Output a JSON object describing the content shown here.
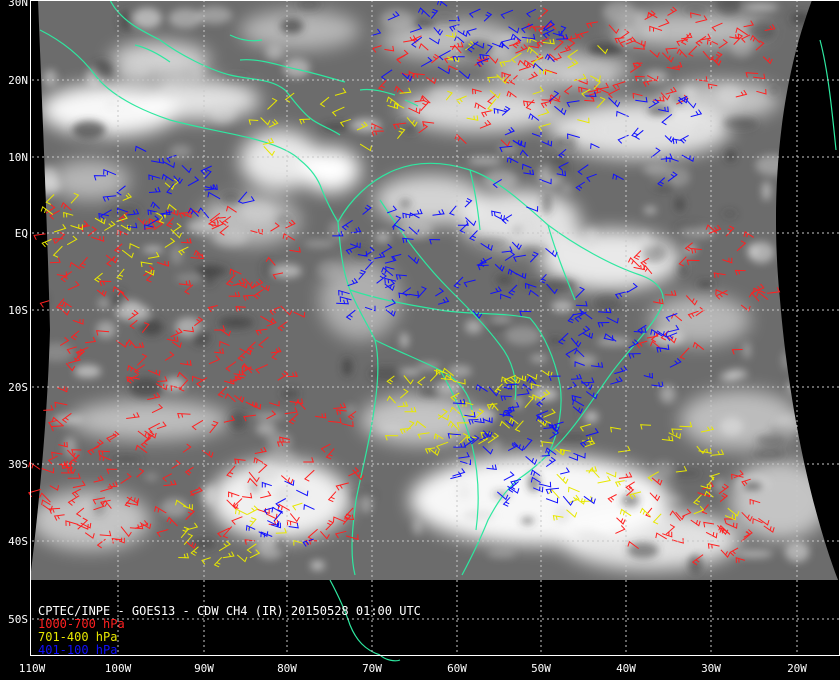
{
  "map": {
    "title": "CPTEC/INPE - GOES13 - CDW CH4 (IR) 20150528 01:00 UTC",
    "lat_labels": [
      "30N",
      "20N",
      "10N",
      "EQ",
      "10S",
      "20S",
      "30S",
      "40S",
      "50S"
    ],
    "lon_labels": [
      "110W",
      "100W",
      "90W",
      "80W",
      "70W",
      "60W",
      "50W",
      "40W",
      "30W",
      "20W"
    ],
    "legend": [
      {
        "label": "1000-700 hPa",
        "color": "#ff2020"
      },
      {
        "label": "701-400 hPa",
        "color": "#e8e800"
      },
      {
        "label": "401-100 hPa",
        "color": "#1010ff"
      }
    ],
    "colors": {
      "background": "#000000",
      "coastline": "#2ee8a0",
      "gridline": "#c8c8c8",
      "imagery_base": "#6e6e6e"
    }
  }
}
